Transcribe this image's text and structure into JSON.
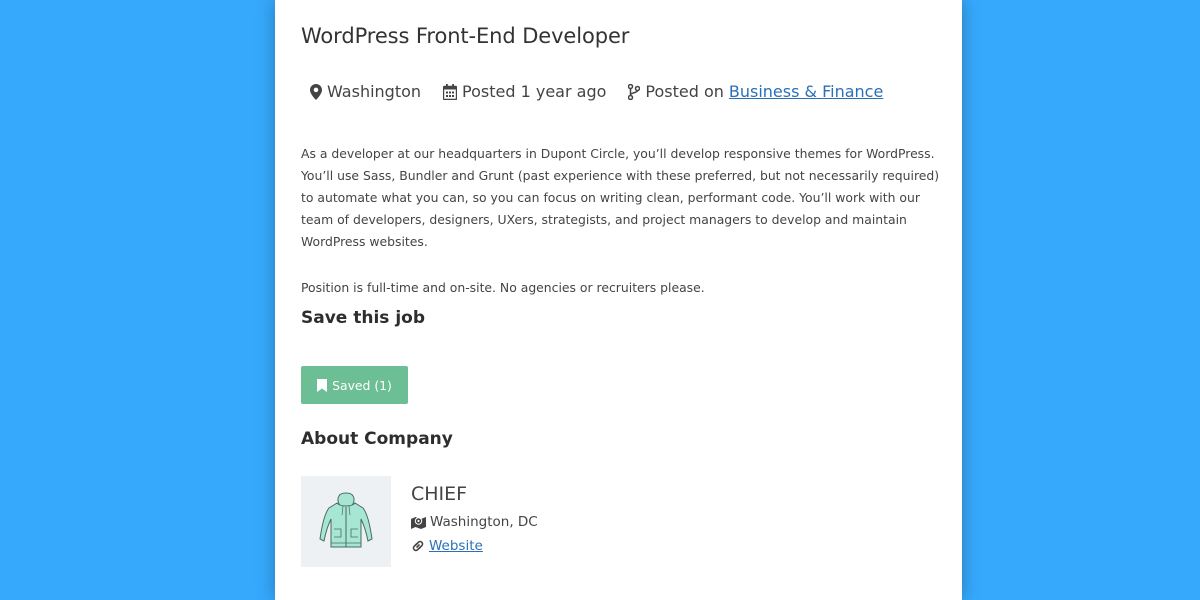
{
  "job": {
    "title": "WordPress Front-End Developer",
    "location": "Washington",
    "posted": "Posted 1 year ago",
    "posted_on_label": "Posted on",
    "category": "Business & Finance"
  },
  "description": {
    "paragraph1": "As a developer at our headquarters in Dupont Circle, you’ll develop responsive themes for WordPress. You’ll use Sass, Bundler and Grunt (past experience with these preferred, but not necessarily required) to automate what you can, so you can focus on writing clean, performant code. You’ll work with our team of developers, designers, UXers, strategists, and project managers to develop and maintain WordPress websites.",
    "paragraph2": "Position is full-time and on-site. No agencies or recruiters please."
  },
  "save_section": {
    "heading": "Save this job",
    "button_label": "Saved (1)"
  },
  "about_section": {
    "heading": "About Company"
  },
  "company": {
    "name": "CHIEF",
    "location": "Washington, DC",
    "website_label": "Website"
  },
  "colors": {
    "page_background": "#36a9fd",
    "card_background": "#ffffff",
    "saved_button": "#6cbf94",
    "link": "#2a70b8"
  },
  "icons": {
    "location": "map-marker-icon",
    "posted": "calendar-icon",
    "category": "code-branch-icon",
    "saved": "bookmark-icon",
    "company_location": "map-icon",
    "website": "link-icon",
    "logo": "hoodie-logo"
  }
}
